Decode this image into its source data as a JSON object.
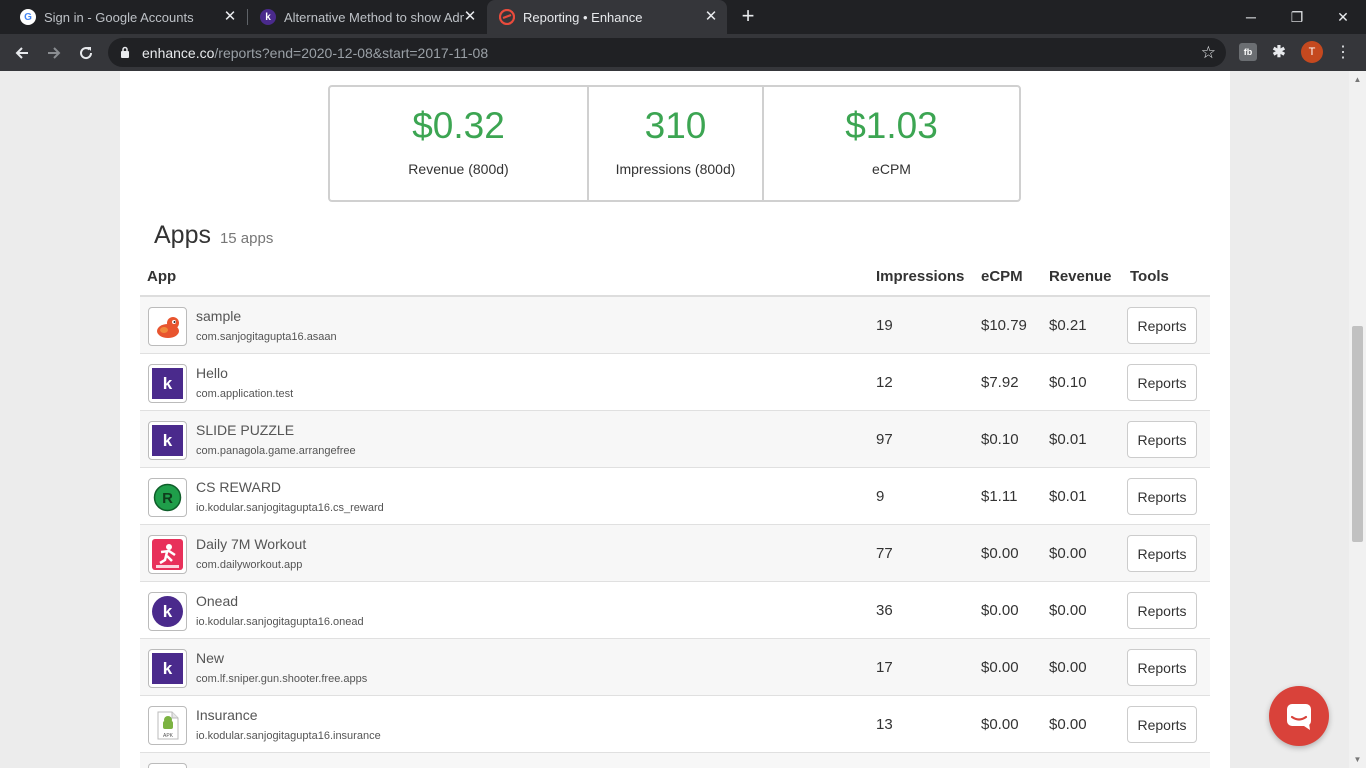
{
  "browser": {
    "tabs": [
      {
        "title": "Sign in - Google Accounts",
        "icon": "google-icon",
        "active": false
      },
      {
        "title": "Alternative Method to show Adm",
        "icon": "kodular-icon",
        "active": false
      },
      {
        "title": "Reporting • Enhance",
        "icon": "enhance-icon",
        "active": true
      }
    ],
    "new_tab": "+",
    "window_controls": {
      "minimize": "─",
      "restore": "❐",
      "close": "✕"
    },
    "url_host": "enhance.co",
    "url_path": "/reports?end=2020-12-08&start=2017-11-08",
    "profile_initial": "T"
  },
  "stats": [
    {
      "value": "$0.32",
      "label": "Revenue (800d)"
    },
    {
      "value": "310",
      "label": "Impressions (800d)"
    },
    {
      "value": "$1.03",
      "label": "eCPM"
    }
  ],
  "apps": {
    "title": "Apps",
    "count": "15 apps",
    "headers": {
      "app": "App",
      "impressions": "Impressions",
      "ecpm": "eCPM",
      "revenue": "Revenue",
      "tools": "Tools"
    },
    "rows": [
      {
        "name": "sample",
        "package": "com.sanjogitagupta16.asaan",
        "impressions": "19",
        "ecpm": "$10.79",
        "revenue": "$0.21",
        "action": "Reports",
        "icon": "sample-app-icon"
      },
      {
        "name": "Hello",
        "package": "com.application.test",
        "impressions": "12",
        "ecpm": "$7.92",
        "revenue": "$0.10",
        "action": "Reports",
        "icon": "kodular-app-icon"
      },
      {
        "name": "SLIDE PUZZLE",
        "package": "com.panagola.game.arrangefree",
        "impressions": "97",
        "ecpm": "$0.10",
        "revenue": "$0.01",
        "action": "Reports",
        "icon": "kodular-app-icon"
      },
      {
        "name": "CS REWARD",
        "package": "io.kodular.sanjogitagupta16.cs_reward",
        "impressions": "9",
        "ecpm": "$1.11",
        "revenue": "$0.01",
        "action": "Reports",
        "icon": "reward-app-icon"
      },
      {
        "name": "Daily 7M Workout",
        "package": "com.dailyworkout.app",
        "impressions": "77",
        "ecpm": "$0.00",
        "revenue": "$0.00",
        "action": "Reports",
        "icon": "workout-app-icon"
      },
      {
        "name": "Onead",
        "package": "io.kodular.sanjogitagupta16.onead",
        "impressions": "36",
        "ecpm": "$0.00",
        "revenue": "$0.00",
        "action": "Reports",
        "icon": "kodular-round-app-icon"
      },
      {
        "name": "New",
        "package": "com.lf.sniper.gun.shooter.free.apps",
        "impressions": "17",
        "ecpm": "$0.00",
        "revenue": "$0.00",
        "action": "Reports",
        "icon": "kodular-app-icon"
      },
      {
        "name": "Insurance",
        "package": "io.kodular.sanjogitagupta16.insurance",
        "impressions": "13",
        "ecpm": "$0.00",
        "revenue": "$0.00",
        "action": "Reports",
        "icon": "apk-file-icon"
      }
    ]
  },
  "colors": {
    "accent_green": "#3ca552",
    "kodular_purple": "#4a2a8c",
    "chat_red": "#d9423a"
  }
}
